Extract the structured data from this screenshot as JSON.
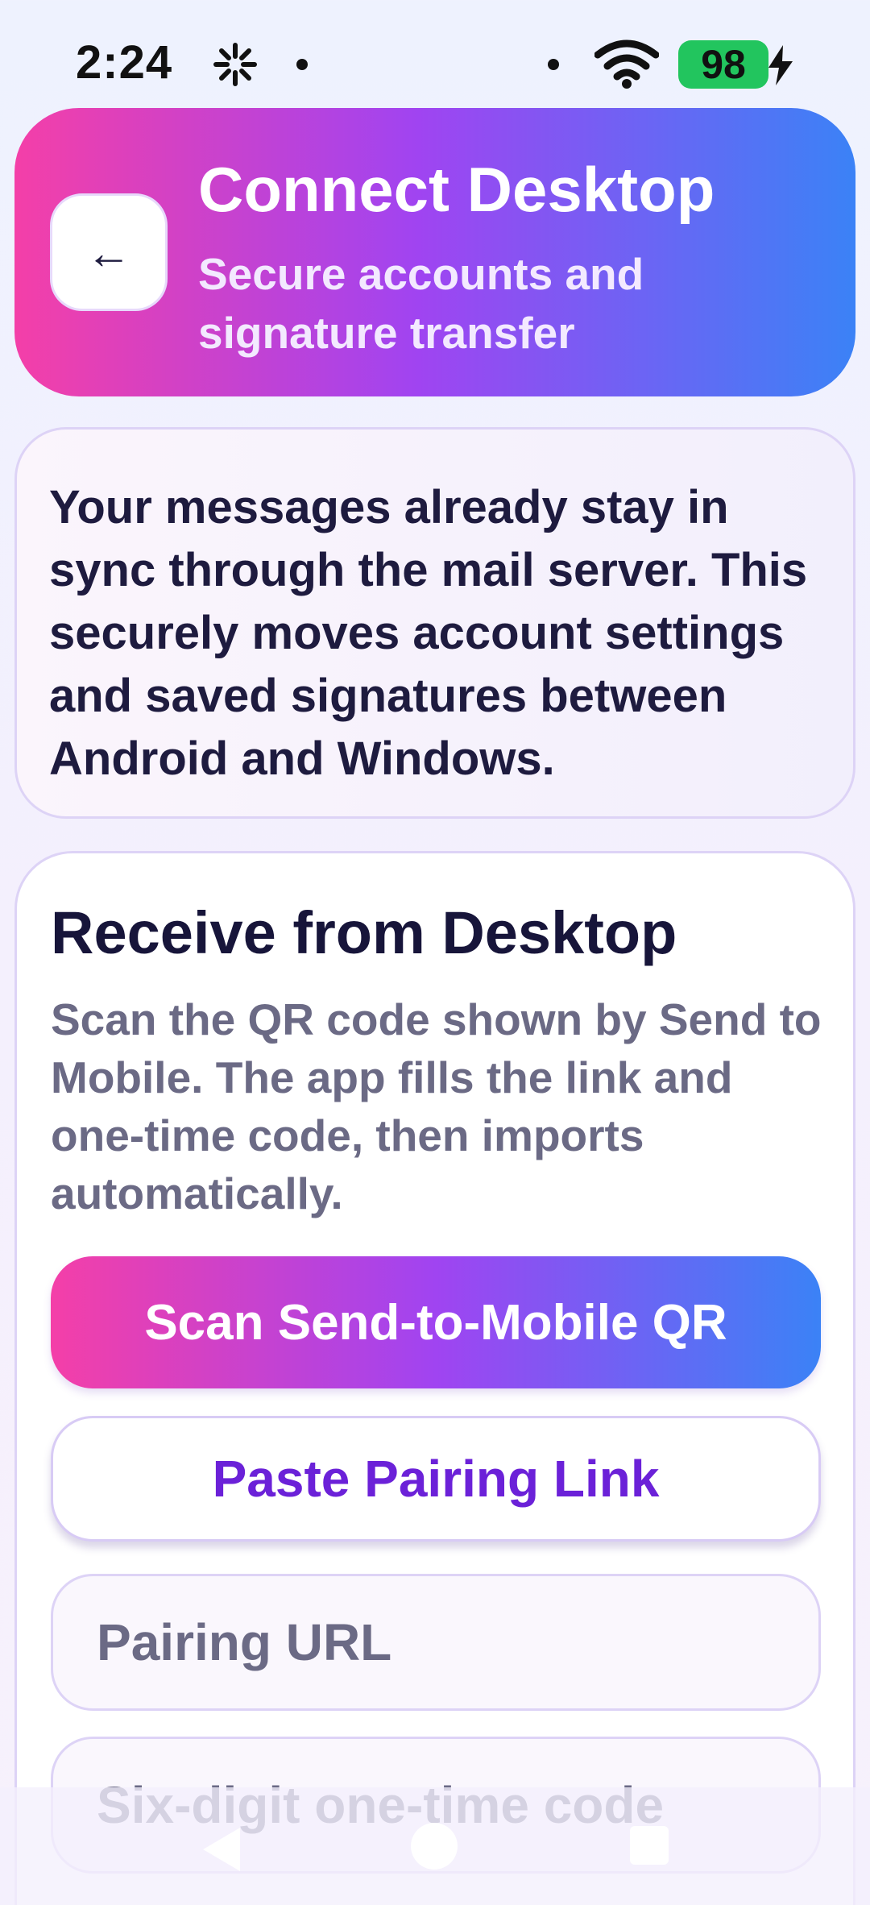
{
  "status_bar": {
    "time": "2:24",
    "battery": "98",
    "icons": [
      "loading-spinner-icon",
      "wifi-icon",
      "battery-icon",
      "charging-bolt-icon"
    ]
  },
  "header": {
    "back_label": "←",
    "title": "Connect Desktop",
    "subtitle": "Secure accounts and signature transfer"
  },
  "info": {
    "text": "Your messages already stay in sync through the mail server. This securely moves account settings and saved signatures between Android and Windows."
  },
  "receive": {
    "title": "Receive from Desktop",
    "description": "Scan the QR code shown by Send to Mobile. The app fills the link and one-time code, then imports automatically.",
    "scan_button": "Scan Send-to-Mobile QR",
    "paste_button": "Paste Pairing Link",
    "url_placeholder": "Pairing URL",
    "code_placeholder": "Six-digit one-time code"
  },
  "colors": {
    "gradient_start": "#f43fa8",
    "gradient_mid": "#a044f1",
    "gradient_end": "#3b82f6",
    "accent_text": "#6b21d8",
    "battery_green": "#22c55e"
  }
}
